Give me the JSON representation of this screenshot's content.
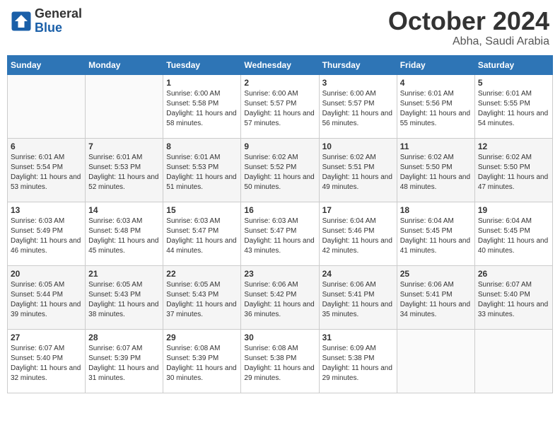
{
  "header": {
    "logo_general": "General",
    "logo_blue": "Blue",
    "month": "October 2024",
    "location": "Abha, Saudi Arabia"
  },
  "days_of_week": [
    "Sunday",
    "Monday",
    "Tuesday",
    "Wednesday",
    "Thursday",
    "Friday",
    "Saturday"
  ],
  "weeks": [
    [
      {
        "day": "",
        "info": ""
      },
      {
        "day": "",
        "info": ""
      },
      {
        "day": "1",
        "info": "Sunrise: 6:00 AM\nSunset: 5:58 PM\nDaylight: 11 hours and 58 minutes."
      },
      {
        "day": "2",
        "info": "Sunrise: 6:00 AM\nSunset: 5:57 PM\nDaylight: 11 hours and 57 minutes."
      },
      {
        "day": "3",
        "info": "Sunrise: 6:00 AM\nSunset: 5:57 PM\nDaylight: 11 hours and 56 minutes."
      },
      {
        "day": "4",
        "info": "Sunrise: 6:01 AM\nSunset: 5:56 PM\nDaylight: 11 hours and 55 minutes."
      },
      {
        "day": "5",
        "info": "Sunrise: 6:01 AM\nSunset: 5:55 PM\nDaylight: 11 hours and 54 minutes."
      }
    ],
    [
      {
        "day": "6",
        "info": "Sunrise: 6:01 AM\nSunset: 5:54 PM\nDaylight: 11 hours and 53 minutes."
      },
      {
        "day": "7",
        "info": "Sunrise: 6:01 AM\nSunset: 5:53 PM\nDaylight: 11 hours and 52 minutes."
      },
      {
        "day": "8",
        "info": "Sunrise: 6:01 AM\nSunset: 5:53 PM\nDaylight: 11 hours and 51 minutes."
      },
      {
        "day": "9",
        "info": "Sunrise: 6:02 AM\nSunset: 5:52 PM\nDaylight: 11 hours and 50 minutes."
      },
      {
        "day": "10",
        "info": "Sunrise: 6:02 AM\nSunset: 5:51 PM\nDaylight: 11 hours and 49 minutes."
      },
      {
        "day": "11",
        "info": "Sunrise: 6:02 AM\nSunset: 5:50 PM\nDaylight: 11 hours and 48 minutes."
      },
      {
        "day": "12",
        "info": "Sunrise: 6:02 AM\nSunset: 5:50 PM\nDaylight: 11 hours and 47 minutes."
      }
    ],
    [
      {
        "day": "13",
        "info": "Sunrise: 6:03 AM\nSunset: 5:49 PM\nDaylight: 11 hours and 46 minutes."
      },
      {
        "day": "14",
        "info": "Sunrise: 6:03 AM\nSunset: 5:48 PM\nDaylight: 11 hours and 45 minutes."
      },
      {
        "day": "15",
        "info": "Sunrise: 6:03 AM\nSunset: 5:47 PM\nDaylight: 11 hours and 44 minutes."
      },
      {
        "day": "16",
        "info": "Sunrise: 6:03 AM\nSunset: 5:47 PM\nDaylight: 11 hours and 43 minutes."
      },
      {
        "day": "17",
        "info": "Sunrise: 6:04 AM\nSunset: 5:46 PM\nDaylight: 11 hours and 42 minutes."
      },
      {
        "day": "18",
        "info": "Sunrise: 6:04 AM\nSunset: 5:45 PM\nDaylight: 11 hours and 41 minutes."
      },
      {
        "day": "19",
        "info": "Sunrise: 6:04 AM\nSunset: 5:45 PM\nDaylight: 11 hours and 40 minutes."
      }
    ],
    [
      {
        "day": "20",
        "info": "Sunrise: 6:05 AM\nSunset: 5:44 PM\nDaylight: 11 hours and 39 minutes."
      },
      {
        "day": "21",
        "info": "Sunrise: 6:05 AM\nSunset: 5:43 PM\nDaylight: 11 hours and 38 minutes."
      },
      {
        "day": "22",
        "info": "Sunrise: 6:05 AM\nSunset: 5:43 PM\nDaylight: 11 hours and 37 minutes."
      },
      {
        "day": "23",
        "info": "Sunrise: 6:06 AM\nSunset: 5:42 PM\nDaylight: 11 hours and 36 minutes."
      },
      {
        "day": "24",
        "info": "Sunrise: 6:06 AM\nSunset: 5:41 PM\nDaylight: 11 hours and 35 minutes."
      },
      {
        "day": "25",
        "info": "Sunrise: 6:06 AM\nSunset: 5:41 PM\nDaylight: 11 hours and 34 minutes."
      },
      {
        "day": "26",
        "info": "Sunrise: 6:07 AM\nSunset: 5:40 PM\nDaylight: 11 hours and 33 minutes."
      }
    ],
    [
      {
        "day": "27",
        "info": "Sunrise: 6:07 AM\nSunset: 5:40 PM\nDaylight: 11 hours and 32 minutes."
      },
      {
        "day": "28",
        "info": "Sunrise: 6:07 AM\nSunset: 5:39 PM\nDaylight: 11 hours and 31 minutes."
      },
      {
        "day": "29",
        "info": "Sunrise: 6:08 AM\nSunset: 5:39 PM\nDaylight: 11 hours and 30 minutes."
      },
      {
        "day": "30",
        "info": "Sunrise: 6:08 AM\nSunset: 5:38 PM\nDaylight: 11 hours and 29 minutes."
      },
      {
        "day": "31",
        "info": "Sunrise: 6:09 AM\nSunset: 5:38 PM\nDaylight: 11 hours and 29 minutes."
      },
      {
        "day": "",
        "info": ""
      },
      {
        "day": "",
        "info": ""
      }
    ]
  ]
}
